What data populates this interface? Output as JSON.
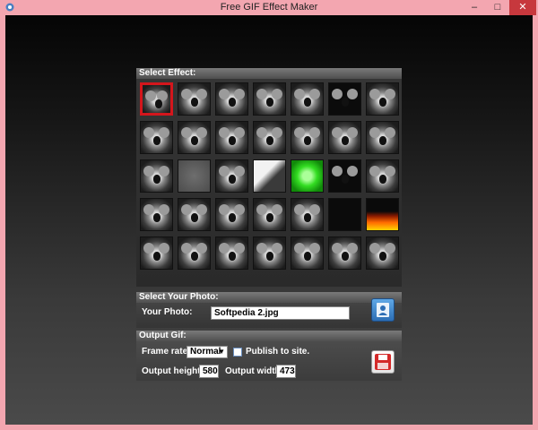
{
  "window": {
    "title": "Free GIF Effect Maker",
    "minimize": "–",
    "maximize": "□",
    "close": "✕"
  },
  "effects": {
    "header": "Select Effect:",
    "items": [
      "koala",
      "koala",
      "koala",
      "koala",
      "mirror",
      "dark-koala",
      "wide",
      "koala",
      "split",
      "koala",
      "koala",
      "koala",
      "koala",
      "koala",
      "koala",
      "emboss",
      "koala",
      "white-swirl",
      "green",
      "dark-koala",
      "koala",
      "koala",
      "gray",
      "koala",
      "koala",
      "koala",
      "dark",
      "fire",
      "koala",
      "koala",
      "koala",
      "koala",
      "polaroid",
      "puzzle",
      "koala"
    ],
    "selected_index": 0
  },
  "photo": {
    "header": "Select Your Photo:",
    "label": "Your Photo:",
    "value": "Softpedia 2.jpg",
    "button_icon": "person-icon"
  },
  "gif": {
    "header": "Output Gif:",
    "frame_rate_label": "Frame rate:",
    "frame_rate_value": "Normal",
    "publish_label": "Publish to site.",
    "height_label": "Output height:",
    "height_value": "580",
    "width_label": "Output width:",
    "width_value": "473",
    "save_icon": "floppy-save-icon"
  }
}
